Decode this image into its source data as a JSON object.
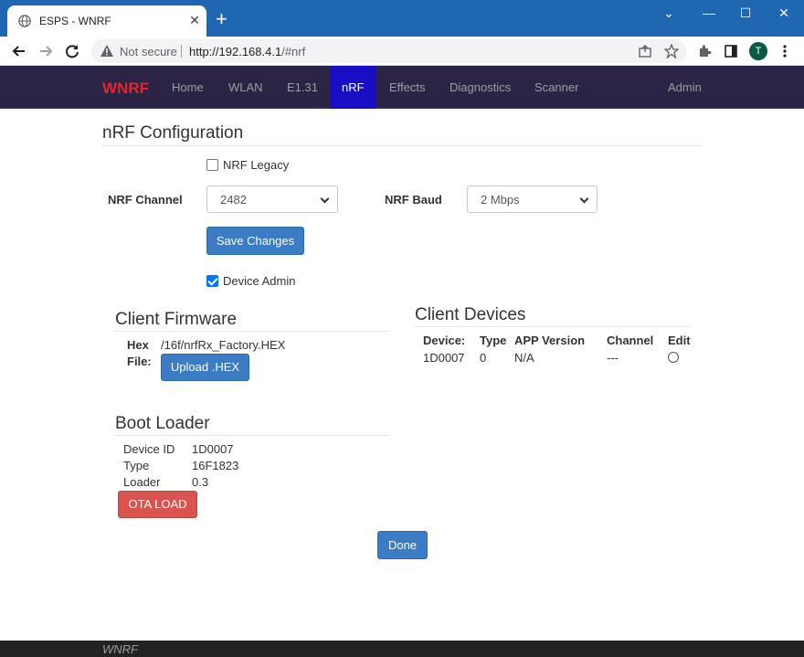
{
  "browser": {
    "tab_title": "ESPS - WNRF",
    "tab_close": "✕",
    "new_tab": "+",
    "window_controls": {
      "minimize": "—",
      "maximize": "☐",
      "close": "✕",
      "tabs_menu": "⌄"
    },
    "security_label": "Not secure",
    "url_host": "http://192.168.4.1",
    "url_path": "/#nrf",
    "profile_initial": "T",
    "accent_color": "#1f67b1"
  },
  "nav": {
    "brand": "WNRF",
    "items": [
      {
        "label": "Home"
      },
      {
        "label": "WLAN"
      },
      {
        "label": "E1.31"
      },
      {
        "label": "nRF",
        "active": true
      },
      {
        "label": "Effects"
      },
      {
        "label": "Diagnostics"
      },
      {
        "label": "Scanner"
      },
      {
        "label": "Admin"
      }
    ],
    "brand_color": "#e5242b",
    "background_color": "#2c2445",
    "active_color": "#1a0ec4"
  },
  "config": {
    "heading": "nRF Configuration",
    "legacy_label": "NRF Legacy",
    "legacy_checked": false,
    "channel_label": "NRF Channel",
    "channel_value": "2482",
    "baud_label": "NRF Baud",
    "baud_value": "2 Mbps",
    "save_label": "Save Changes",
    "device_admin_label": "Device Admin",
    "device_admin_checked": true
  },
  "firmware": {
    "heading": "Client Firmware",
    "hex_label_line1": "Hex",
    "hex_label_line2": "File:",
    "hex_path": "/16f/nrfRx_Factory.HEX",
    "upload_label": "Upload .HEX"
  },
  "devices": {
    "heading": "Client Devices",
    "columns": [
      "Device:",
      "Type",
      "APP Version",
      "Channel",
      "Edit"
    ],
    "rows": [
      {
        "device": "1D0007",
        "type": "0",
        "app_version": "N/A",
        "channel": "---",
        "edit_selected": false
      }
    ]
  },
  "bootloader": {
    "heading": "Boot Loader",
    "fields": [
      {
        "label": "Device ID",
        "value": "1D0007"
      },
      {
        "label": "Type",
        "value": "16F1823"
      },
      {
        "label": "Loader",
        "value": "0.3"
      }
    ],
    "ota_label": "OTA LOAD"
  },
  "done_label": "Done",
  "footer_text": "WNRF"
}
